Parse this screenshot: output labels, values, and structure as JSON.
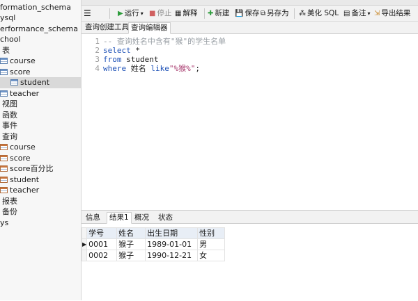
{
  "sidebar": {
    "items": [
      {
        "label": "formation_schema",
        "icon": "none",
        "x": 0
      },
      {
        "label": "ysql",
        "icon": "none",
        "x": 0
      },
      {
        "label": "erformance_schema",
        "icon": "none",
        "x": 0
      },
      {
        "label": "chool",
        "icon": "none",
        "x": 0
      },
      {
        "label": "表",
        "icon": "none",
        "x": 3
      },
      {
        "label": "course",
        "icon": "table",
        "x": 0
      },
      {
        "label": "score",
        "icon": "table",
        "x": 0
      },
      {
        "label": "student",
        "icon": "table",
        "x": 0,
        "selected": true
      },
      {
        "label": "teacher",
        "icon": "table",
        "x": 0
      },
      {
        "label": "视图",
        "icon": "none",
        "x": 3
      },
      {
        "label": "函数",
        "icon": "none",
        "x": 3
      },
      {
        "label": "事件",
        "icon": "none",
        "x": 3
      },
      {
        "label": "查询",
        "icon": "none",
        "x": 3
      },
      {
        "label": "course",
        "icon": "view",
        "x": 0
      },
      {
        "label": "score",
        "icon": "view",
        "x": 0
      },
      {
        "label": "score百分比",
        "icon": "view",
        "x": 0
      },
      {
        "label": "student",
        "icon": "view",
        "x": 0
      },
      {
        "label": "teacher",
        "icon": "view",
        "x": 0
      },
      {
        "label": "报表",
        "icon": "none",
        "x": 3
      },
      {
        "label": "备份",
        "icon": "none",
        "x": 3
      },
      {
        "label": "ys",
        "icon": "none",
        "x": 0
      }
    ]
  },
  "toolbar": {
    "run": "运行",
    "stop": "停止",
    "explain": "解释",
    "new": "新建",
    "save": "保存",
    "save_as": "另存为",
    "beautify": "美化 SQL",
    "comment": "备注",
    "export": "导出结果"
  },
  "subtabs": [
    "查询创建工具",
    "查询编辑器"
  ],
  "editor": {
    "line_numbers": [
      "1",
      "2",
      "3",
      "4"
    ],
    "line1_comment": "-- 查询姓名中含有\"猴\"的学生名单",
    "line2_kw": "select",
    "line2_rest": " *",
    "line3_kw": "from",
    "line3_rest": " student",
    "line4_kw": "where",
    "line4_mid": " 姓名 ",
    "line4_kw2": "like",
    "line4_str": "\"%猴%\"",
    "line4_end": ";"
  },
  "result_tabs": [
    "信息",
    "结果1",
    "概况",
    "状态"
  ],
  "results": {
    "columns": [
      "学号",
      "姓名",
      "出生日期",
      "性别"
    ],
    "rows": [
      [
        "0001",
        "猴子",
        "1989-01-01",
        "男"
      ],
      [
        "0002",
        "猴子",
        "1990-12-21",
        "女"
      ]
    ]
  },
  "colors": {
    "accent_green": "#2d9c3c",
    "stop_red": "#d06060",
    "keyword_blue": "#1f52b7",
    "string_pink": "#a83a6e"
  }
}
